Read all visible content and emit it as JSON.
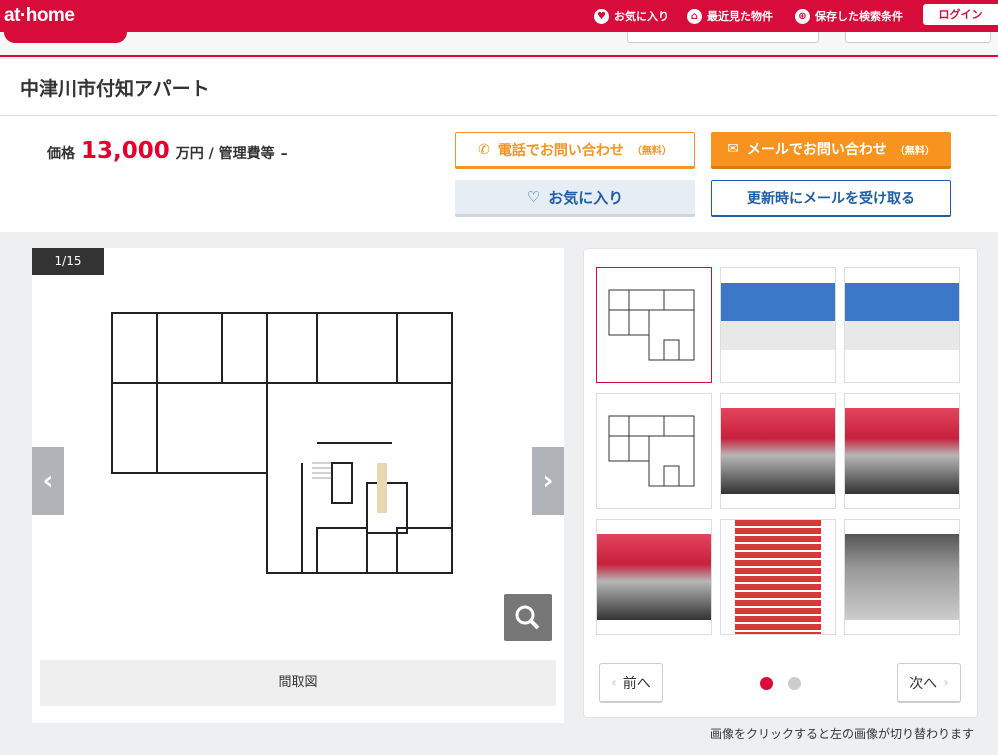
{
  "header": {
    "logo": "at·home",
    "nav": [
      {
        "label": "お気に入り",
        "icon": "heart-icon"
      },
      {
        "label": "最近見た物件",
        "icon": "home-icon"
      },
      {
        "label": "保存した検索条件",
        "icon": "save-icon"
      }
    ],
    "login": "ログイン"
  },
  "property": {
    "title": "中津川市付知アパート",
    "price_label": "価格",
    "price": "13,000",
    "price_unit": "万円 / 管理費等",
    "fee": "–"
  },
  "actions": {
    "tel": "電話でお問い合わせ",
    "tel_note": "（無料）",
    "mail": "メールでお問い合わせ",
    "mail_note": "（無料）",
    "favorite": "お気に入り",
    "notify": "更新時にメールを受け取る"
  },
  "gallery": {
    "counter": "1/15",
    "caption": "間取図",
    "prev": "前へ",
    "next": "次へ",
    "hint": "画像をクリックすると左の画像が切り替わります",
    "pages": 2,
    "current_page": 1,
    "thumbnails": [
      {
        "type": "floorplan",
        "selected": true
      },
      {
        "type": "exterior"
      },
      {
        "type": "exterior"
      },
      {
        "type": "floorplan"
      },
      {
        "type": "interior-red"
      },
      {
        "type": "interior-red"
      },
      {
        "type": "interior-red"
      },
      {
        "type": "stairs"
      },
      {
        "type": "bathroom"
      }
    ]
  },
  "colors": {
    "brand": "#d70c3a",
    "accent": "#f7931e",
    "link": "#1e5ea8"
  }
}
